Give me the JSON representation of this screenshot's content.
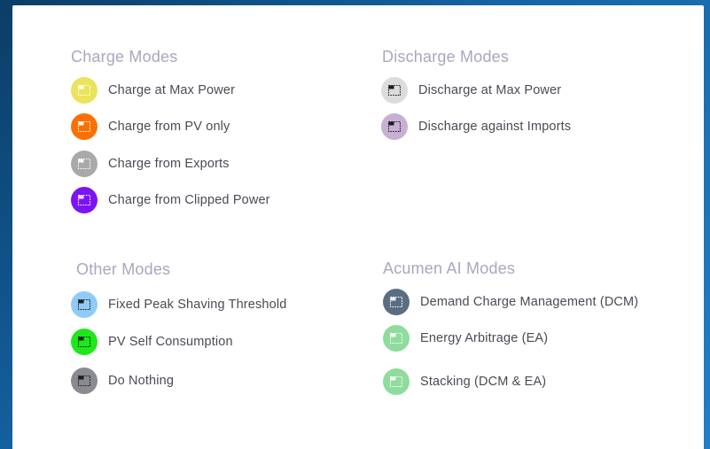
{
  "charge": {
    "title": "Charge Modes",
    "items": [
      {
        "label": "Charge at Max Power",
        "color": "#ebe35a",
        "icon": "battery-icon",
        "glyph": "light"
      },
      {
        "label": "Charge from PV only",
        "color": "#fb7000",
        "icon": "battery-icon",
        "glyph": "light"
      },
      {
        "label": "Charge from Exports",
        "color": "#a9a9a9",
        "icon": "battery-icon",
        "glyph": "light"
      },
      {
        "label": "Charge from Clipped Power",
        "color": "#7d12f5",
        "icon": "battery-icon",
        "glyph": "light"
      }
    ]
  },
  "discharge": {
    "title": "Discharge Modes",
    "items": [
      {
        "label": "Discharge at Max Power",
        "color": "#dcdcdc",
        "icon": "battery-icon",
        "glyph": "dark"
      },
      {
        "label": "Discharge against Imports",
        "color": "#c7b0d3",
        "icon": "battery-icon",
        "glyph": "dark"
      }
    ]
  },
  "other": {
    "title": "Other Modes",
    "items": [
      {
        "label": "Fixed Peak Shaving Threshold",
        "color": "#8fcbf6",
        "icon": "battery-icon",
        "glyph": "dark"
      },
      {
        "label": "PV Self Consumption",
        "color": "#1ee81a",
        "icon": "battery-icon",
        "glyph": "dark"
      },
      {
        "label": "Do Nothing",
        "color": "#8a8a91",
        "icon": "battery-icon",
        "glyph": "dark"
      }
    ]
  },
  "acumen": {
    "title": "Acumen AI Modes",
    "items": [
      {
        "label": "Demand Charge Management (DCM)",
        "color": "#5a6e82",
        "icon": "battery-icon",
        "glyph": "light"
      },
      {
        "label": "Energy Arbitrage (EA)",
        "color": "#8fdc9c",
        "icon": "battery-icon",
        "glyph": "light"
      },
      {
        "label": "Stacking (DCM & EA)",
        "color": "#8fdc9c",
        "icon": "battery-icon",
        "glyph": "light"
      }
    ]
  }
}
